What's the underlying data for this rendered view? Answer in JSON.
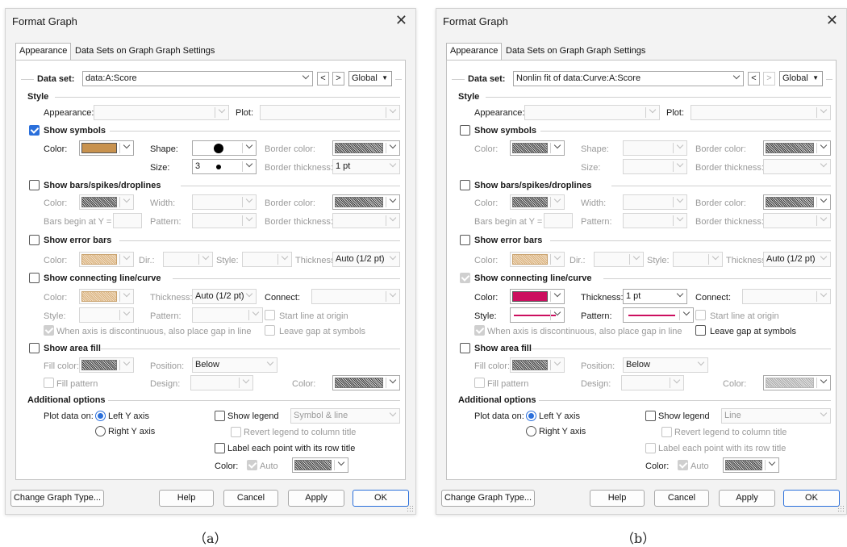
{
  "dialogs": [
    {
      "title": "Format Graph",
      "tabs": [
        "Appearance",
        "Data Sets on Graph",
        "Graph Settings"
      ],
      "data_set_label": "Data set:",
      "data_set_value": "data:A:Score",
      "prev_label": "<",
      "next_label": ">",
      "global_label": "Global",
      "style_section": "Style",
      "appearance_label": "Appearance:",
      "plot_label": "Plot:",
      "show_symbols": {
        "label": "Show symbols",
        "checked": true,
        "color_label": "Color:",
        "color_hex": "#c8924e",
        "shape_label": "Shape:",
        "size_label": "Size:",
        "size_value": "3",
        "border_color_label": "Border color:",
        "border_thickness_label": "Border thickness:",
        "border_thickness_value": "1 pt"
      },
      "show_bars": {
        "label": "Show bars/spikes/droplines",
        "checked": false,
        "color_label": "Color:",
        "width_label": "Width:",
        "border_color_label": "Border color:",
        "bars_begin_label": "Bars begin at Y =",
        "pattern_label": "Pattern:",
        "border_thickness_label": "Border thickness:"
      },
      "show_error_bars": {
        "label": "Show error bars",
        "checked": false,
        "color_label": "Color:",
        "dir_label": "Dir.:",
        "style_label": "Style:",
        "thickness_label": "Thickness",
        "thickness_value": "Auto (1/2 pt)"
      },
      "show_line": {
        "label": "Show connecting line/curve",
        "checked": false,
        "color_label": "Color:",
        "color_hex": "",
        "thickness_label": "Thickness:",
        "thickness_value": "Auto (1/2 pt)",
        "connect_label": "Connect:",
        "style_label": "Style:",
        "pattern_label": "Pattern:",
        "start_origin_label": "Start line at origin",
        "gap_label": "When axis is discontinuous, also place gap in line",
        "leave_gap_label": "Leave gap at symbols"
      },
      "show_area": {
        "label": "Show area fill",
        "checked": false,
        "fill_color_label": "Fill color:",
        "position_label": "Position:",
        "position_value": "Below",
        "fill_pattern_label": "Fill pattern",
        "design_label": "Design:",
        "color_label": "Color:"
      },
      "additional": {
        "label": "Additional options",
        "plot_on_label": "Plot data on:",
        "left_y": "Left Y axis",
        "right_y": "Right  Y axis",
        "show_legend_label": "Show legend",
        "legend_value": "Symbol & line",
        "revert_legend_label": "Revert legend to column title",
        "label_points_label": "Label each point with its row title",
        "color_label": "Color:",
        "auto_label": "Auto"
      },
      "buttons": {
        "change_type": "Change Graph Type...",
        "help": "Help",
        "cancel": "Cancel",
        "apply": "Apply",
        "ok": "OK"
      },
      "caption": "（a）"
    },
    {
      "title": "Format Graph",
      "tabs": [
        "Appearance",
        "Data Sets on Graph",
        "Graph Settings"
      ],
      "data_set_label": "Data set:",
      "data_set_value": "Nonlin fit of data:Curve:A:Score",
      "prev_label": "<",
      "next_label": ">",
      "global_label": "Global",
      "style_section": "Style",
      "appearance_label": "Appearance:",
      "plot_label": "Plot:",
      "show_symbols": {
        "label": "Show symbols",
        "checked": false,
        "color_label": "Color:",
        "color_hex": "",
        "shape_label": "Shape:",
        "size_label": "Size:",
        "size_value": "",
        "border_color_label": "Border color:",
        "border_thickness_label": "Border thickness:",
        "border_thickness_value": ""
      },
      "show_bars": {
        "label": "Show bars/spikes/droplines",
        "checked": false,
        "color_label": "Color:",
        "width_label": "Width:",
        "border_color_label": "Border color:",
        "bars_begin_label": "Bars begin at Y =",
        "pattern_label": "Pattern:",
        "border_thickness_label": "Border thickness:"
      },
      "show_error_bars": {
        "label": "Show error bars",
        "checked": false,
        "color_label": "Color:",
        "dir_label": "Dir.:",
        "style_label": "Style:",
        "thickness_label": "Thickness",
        "thickness_value": "Auto (1/2 pt)"
      },
      "show_line": {
        "label": "Show connecting line/curve",
        "checked": true,
        "color_label": "Color:",
        "color_hex": "#cc0f5f",
        "thickness_label": "Thickness:",
        "thickness_value": "1 pt",
        "connect_label": "Connect:",
        "style_label": "Style:",
        "pattern_label": "Pattern:",
        "start_origin_label": "Start line at origin",
        "gap_label": "When axis is discontinuous, also place gap in line",
        "leave_gap_label": "Leave gap at symbols"
      },
      "show_area": {
        "label": "Show area fill",
        "checked": false,
        "fill_color_label": "Fill color:",
        "position_label": "Position:",
        "position_value": "Below",
        "fill_pattern_label": "Fill pattern",
        "design_label": "Design:",
        "color_label": "Color:"
      },
      "additional": {
        "label": "Additional options",
        "plot_on_label": "Plot data on:",
        "left_y": "Left Y axis",
        "right_y": "Right  Y axis",
        "show_legend_label": "Show legend",
        "legend_value": "Line",
        "revert_legend_label": "Revert legend to column title",
        "label_points_label": "Label each point with its row title",
        "color_label": "Color:",
        "auto_label": "Auto"
      },
      "buttons": {
        "change_type": "Change Graph Type...",
        "help": "Help",
        "cancel": "Cancel",
        "apply": "Apply",
        "ok": "OK"
      },
      "caption": "（b）"
    }
  ],
  "colors": {
    "accent": "#2a6fdb",
    "symbol_color_a": "#c8924e",
    "line_color_b": "#cc0f5f"
  },
  "icons": {
    "close": "close-icon",
    "dropdown": "chevron-down-icon",
    "checkbox": "checkbox-icon",
    "radio": "radio-icon",
    "resize": "resize-grip-icon"
  }
}
